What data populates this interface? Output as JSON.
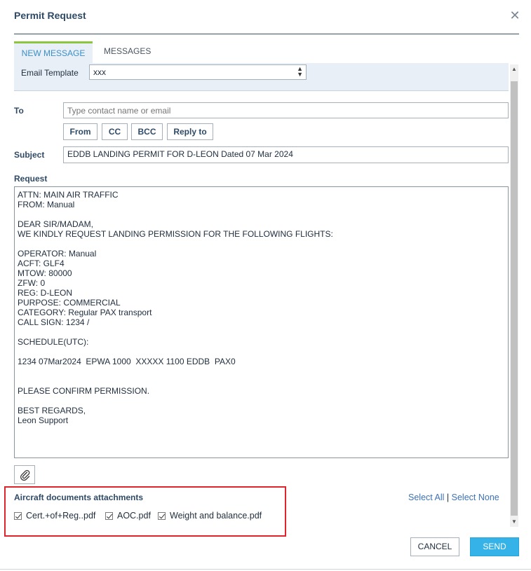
{
  "dialog": {
    "title": "Permit Request",
    "close_icon": "close-icon"
  },
  "tabs": [
    {
      "label": "NEW MESSAGE",
      "active": true
    },
    {
      "label": "MESSAGES",
      "active": false
    }
  ],
  "template": {
    "label": "Email Template",
    "value": "xxx"
  },
  "to": {
    "label": "To",
    "placeholder": "Type contact name or email",
    "buttons": [
      "From",
      "CC",
      "BCC",
      "Reply to"
    ]
  },
  "subject": {
    "label": "Subject",
    "value": "EDDB LANDING PERMIT FOR D-LEON Dated 07 Mar 2024"
  },
  "request": {
    "label": "Request",
    "body": "ATTN: MAIN AIR TRAFFIC\nFROM: Manual\n\nDEAR SIR/MADAM,\nWE KINDLY REQUEST LANDING PERMISSION FOR THE FOLLOWING FLIGHTS:\n\nOPERATOR: Manual\nACFT: GLF4\nMTOW: 80000\nZFW: 0\nREG: D-LEON\nPURPOSE: COMMERCIAL\nCATEGORY: Regular PAX transport\nCALL SIGN: 1234 /\n\nSCHEDULE(UTC):\n\n1234 07Mar2024  EPWA 1000  XXXXX 1100 EDDB  PAX0\n\n\nPLEASE CONFIRM PERMISSION.\n\nBEST REGARDS,\nLeon Support"
  },
  "attachments": {
    "title": "Aircraft documents attachments",
    "select_all": "Select All",
    "separator": "|",
    "select_none": "Select None",
    "files": [
      {
        "name": "Cert.+of+Reg..pdf",
        "checked": true
      },
      {
        "name": "AOC.pdf",
        "checked": true
      },
      {
        "name": "Weight and balance.pdf",
        "checked": true
      }
    ]
  },
  "actions": {
    "cancel": "CANCEL",
    "send": "SEND"
  },
  "colors": {
    "accent": "#8cc63f",
    "link": "#3c72b5",
    "send": "#35b3e8",
    "highlight": "#e0242b"
  }
}
